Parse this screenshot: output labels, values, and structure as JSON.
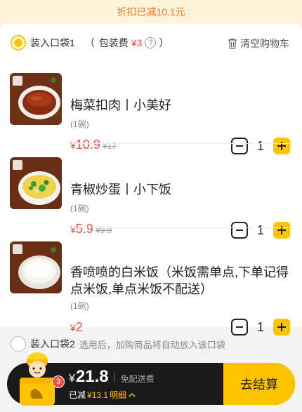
{
  "banner": {
    "text": "折扣已减10.1元"
  },
  "bag1": {
    "label": "装入口袋1",
    "paren_open": "（",
    "fee_label": "包装费",
    "fee_value": "¥3",
    "help": "?",
    "paren_close": "）",
    "clear_label": "清空购物车"
  },
  "items": [
    {
      "name": "梅菜扣肉丨小美好",
      "unit": "(1碗)",
      "currency": "¥",
      "price": "10.9",
      "original_price": "¥17",
      "qty": "1"
    },
    {
      "name": "青椒炒蛋丨小下饭",
      "unit": "(1碗)",
      "currency": "¥",
      "price": "5.9",
      "original_price": "¥9.9",
      "qty": "1"
    },
    {
      "name": "香喷喷的白米饭（米饭需单点,下单记得点米饭,单点米饭不配送）",
      "unit": "(1碗)",
      "currency": "¥",
      "price": "2",
      "original_price": "",
      "qty": "1"
    }
  ],
  "bag2": {
    "label": "装入口袋2",
    "hint": "选用后，加购商品将自动放入该口袋"
  },
  "checkout": {
    "currency": "¥",
    "total": "21.8",
    "shipping": "免配送费",
    "saved_label": "已减",
    "saved_amount": "¥13.1",
    "detail_label": "明细",
    "button_label": "去结算",
    "cart_count": "3"
  },
  "colors": {
    "accent": "#ffc300",
    "price_red": "#ef4d3e",
    "banner_bg": "#fff3dc",
    "banner_text": "#ef7b28",
    "bar_bg": "#1a1a1a"
  }
}
